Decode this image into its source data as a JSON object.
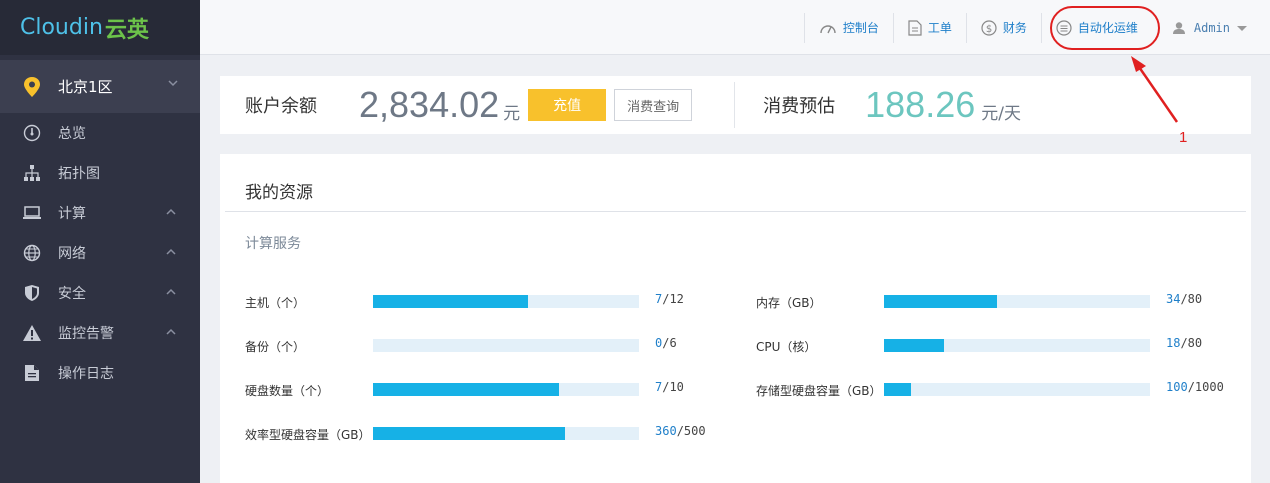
{
  "brand": {
    "logo_en": "Cloudin",
    "logo_zh": "云英"
  },
  "sidebar": {
    "region": "北京1区",
    "items": [
      {
        "label": "总览",
        "icon": "dashboard-icon"
      },
      {
        "label": "拓扑图",
        "icon": "topology-icon"
      },
      {
        "label": "计算",
        "icon": "laptop-icon"
      },
      {
        "label": "网络",
        "icon": "globe-icon"
      },
      {
        "label": "安全",
        "icon": "shield-icon"
      },
      {
        "label": "监控告警",
        "icon": "warning-icon"
      },
      {
        "label": "操作日志",
        "icon": "document-icon"
      }
    ]
  },
  "topnav": {
    "console": "控制台",
    "ticket": "工单",
    "finance": "财务",
    "automation": "自动化运维",
    "user": "Admin"
  },
  "annotation": {
    "number": "1"
  },
  "balance": {
    "label": "账户余额",
    "amount": "2,834.02",
    "unit": "元",
    "recharge": "充值",
    "query": "消费查询",
    "estimate_label": "消费预估",
    "estimate_amount": "188.26",
    "estimate_unit": "元/天"
  },
  "resources": {
    "title": "我的资源",
    "subtitle": "计算服务",
    "left": [
      {
        "label": "主机（个）",
        "used": "7",
        "total": "/12",
        "ratio": 0.583
      },
      {
        "label": "备份（个）",
        "used": "0",
        "total": "/6",
        "ratio": 0
      },
      {
        "label": "硬盘数量（个）",
        "used": "7",
        "total": "/10",
        "ratio": 0.7
      },
      {
        "label": "效率型硬盘容量（GB）",
        "used": "360",
        "total": "/500",
        "ratio": 0.72
      }
    ],
    "right": [
      {
        "label": "内存（GB）",
        "used": "34",
        "total": "/80",
        "ratio": 0.425
      },
      {
        "label": "CPU（核）",
        "used": "18",
        "total": "/80",
        "ratio": 0.225
      },
      {
        "label": "存储型硬盘容量（GB）",
        "used": "100",
        "total": "/1000",
        "ratio": 0.1
      }
    ]
  },
  "colors": {
    "accent": "#16b1e6",
    "recharge": "#f8c12c",
    "estimate": "#6cc6bf",
    "annotation": "#e02020"
  }
}
